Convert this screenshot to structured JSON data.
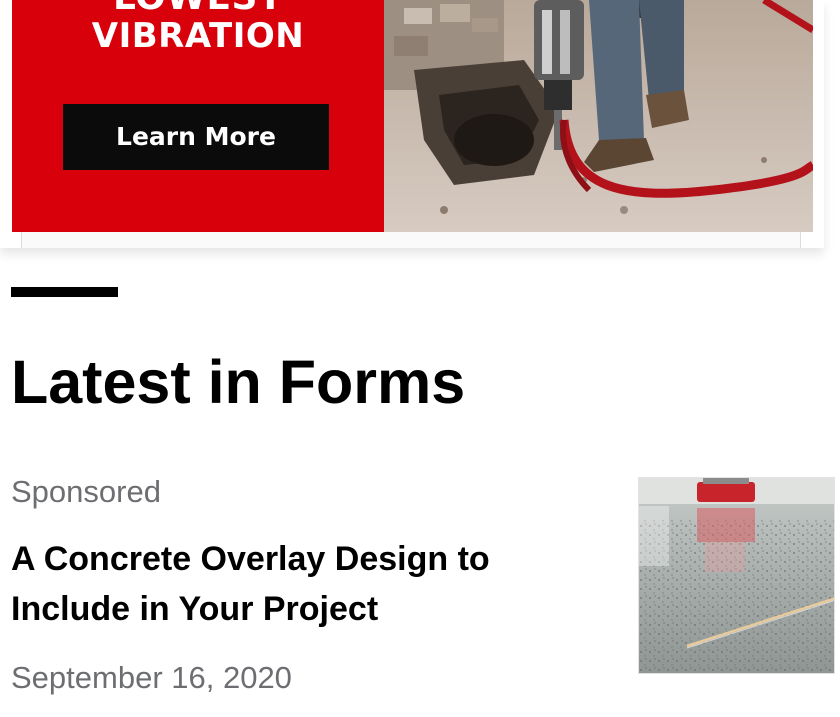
{
  "ad": {
    "headline_top": "LOWEST",
    "headline": "VIBRATION",
    "cta_label": "Learn More",
    "colors": {
      "brand_red": "#d7000b",
      "cta_bg": "#0b0b0b",
      "cta_text": "#ffffff"
    },
    "image_subject": "worker-operating-jackhammer-on-concrete"
  },
  "section": {
    "title": "Latest in Forms"
  },
  "articles": [
    {
      "tag": "Sponsored",
      "title": "A Concrete Overlay Design to Include in Your Project",
      "date": "September 16, 2020",
      "thumbnail_subject": "polished-terrazzo-concrete-floor"
    }
  ],
  "colors": {
    "meta_text": "#6d6e71",
    "heading_text": "#000000",
    "background": "#ffffff"
  }
}
